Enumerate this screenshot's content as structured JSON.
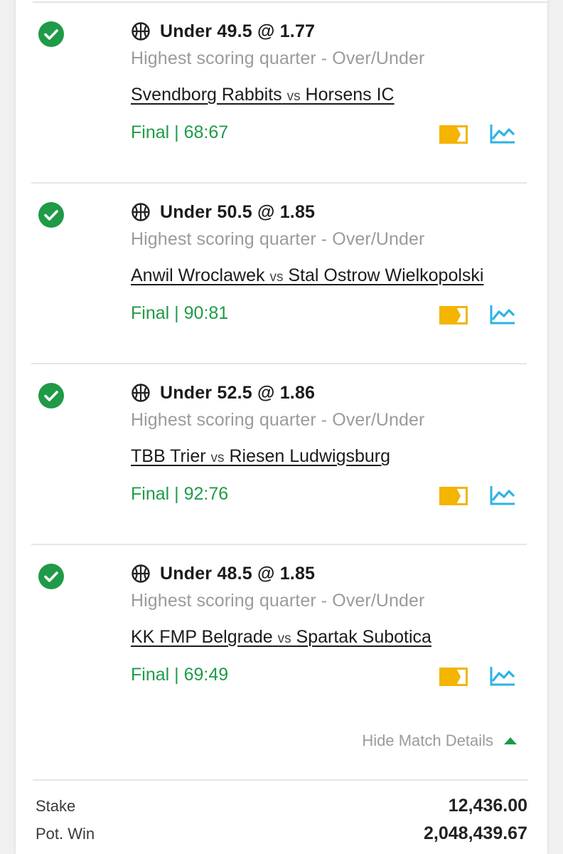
{
  "colors": {
    "accent_green": "#1f9a47",
    "muted_text": "#9b9b9b",
    "tag_yellow": "#f4b400",
    "stats_blue": "#2bb3e6"
  },
  "bets": [
    {
      "status_icon": "check-circle-icon",
      "sport_icon": "basketball-icon",
      "selection": "Under 49.5 @ 1.77",
      "market": "Highest scoring quarter - Over/Under",
      "home": "Svendborg Rabbits",
      "vs": "vs",
      "away": "Horsens IC",
      "result": "Final | 68:67"
    },
    {
      "status_icon": "check-circle-icon",
      "sport_icon": "basketball-icon",
      "selection": "Under 50.5 @ 1.85",
      "market": "Highest scoring quarter - Over/Under",
      "home": "Anwil Wroclawek",
      "vs": "vs",
      "away": "Stal Ostrow Wielkopolski",
      "result": "Final | 90:81"
    },
    {
      "status_icon": "check-circle-icon",
      "sport_icon": "basketball-icon",
      "selection": "Under 52.5 @ 1.86",
      "market": "Highest scoring quarter - Over/Under",
      "home": "TBB Trier",
      "vs": "vs",
      "away": "Riesen Ludwigsburg",
      "result": "Final | 92:76"
    },
    {
      "status_icon": "check-circle-icon",
      "sport_icon": "basketball-icon",
      "selection": "Under 48.5 @ 1.85",
      "market": "Highest scoring quarter - Over/Under",
      "home": "KK FMP Belgrade",
      "vs": "vs",
      "away": "Spartak Subotica",
      "result": "Final | 69:49"
    }
  ],
  "details_toggle": {
    "label": "Hide Match Details",
    "icon": "caret-up-icon"
  },
  "summary": {
    "stake_label": "Stake",
    "stake_value": "12,436.00",
    "pot_win_label": "Pot. Win",
    "pot_win_value": "2,048,439.67"
  }
}
